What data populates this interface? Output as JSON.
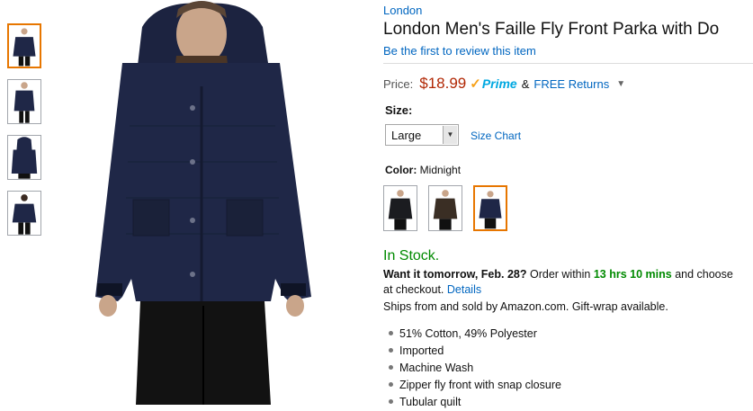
{
  "product": {
    "brand": "London",
    "title": "London Men's Faille Fly Front Parka with Do",
    "review_link": "Be the first to review this item"
  },
  "price": {
    "label": "Price:",
    "value": "$18.99",
    "prime": "Prime",
    "amp": "&",
    "returns": "FREE Returns"
  },
  "size": {
    "label": "Size:",
    "selected": "Large",
    "chart_link": "Size Chart"
  },
  "color": {
    "label": "Color:",
    "selected": "Midnight",
    "swatches": [
      {
        "name": "Black",
        "color": "#1b1c20"
      },
      {
        "name": "Brown",
        "color": "#3a2e24"
      },
      {
        "name": "Midnight",
        "color": "#1f2747"
      }
    ]
  },
  "availability": {
    "status": "In Stock.",
    "want_it": "Want it tomorrow, Feb. 28?",
    "order_within": "Order within",
    "countdown": "13 hrs 10 mins",
    "and_choose": "and choose",
    "at_checkout": "at checkout.",
    "details": "Details",
    "ships": "Ships from and sold by Amazon.com. Gift-wrap available."
  },
  "features": [
    "51% Cotton, 49% Polyester",
    "Imported",
    "Machine Wash",
    "Zipper fly front with snap closure",
    "Tubular quilt"
  ],
  "colors": {
    "link": "#0066c0",
    "price": "#b12704",
    "in_stock": "#008a00",
    "selected_border": "#e77600",
    "jacket": "#1f2747"
  }
}
